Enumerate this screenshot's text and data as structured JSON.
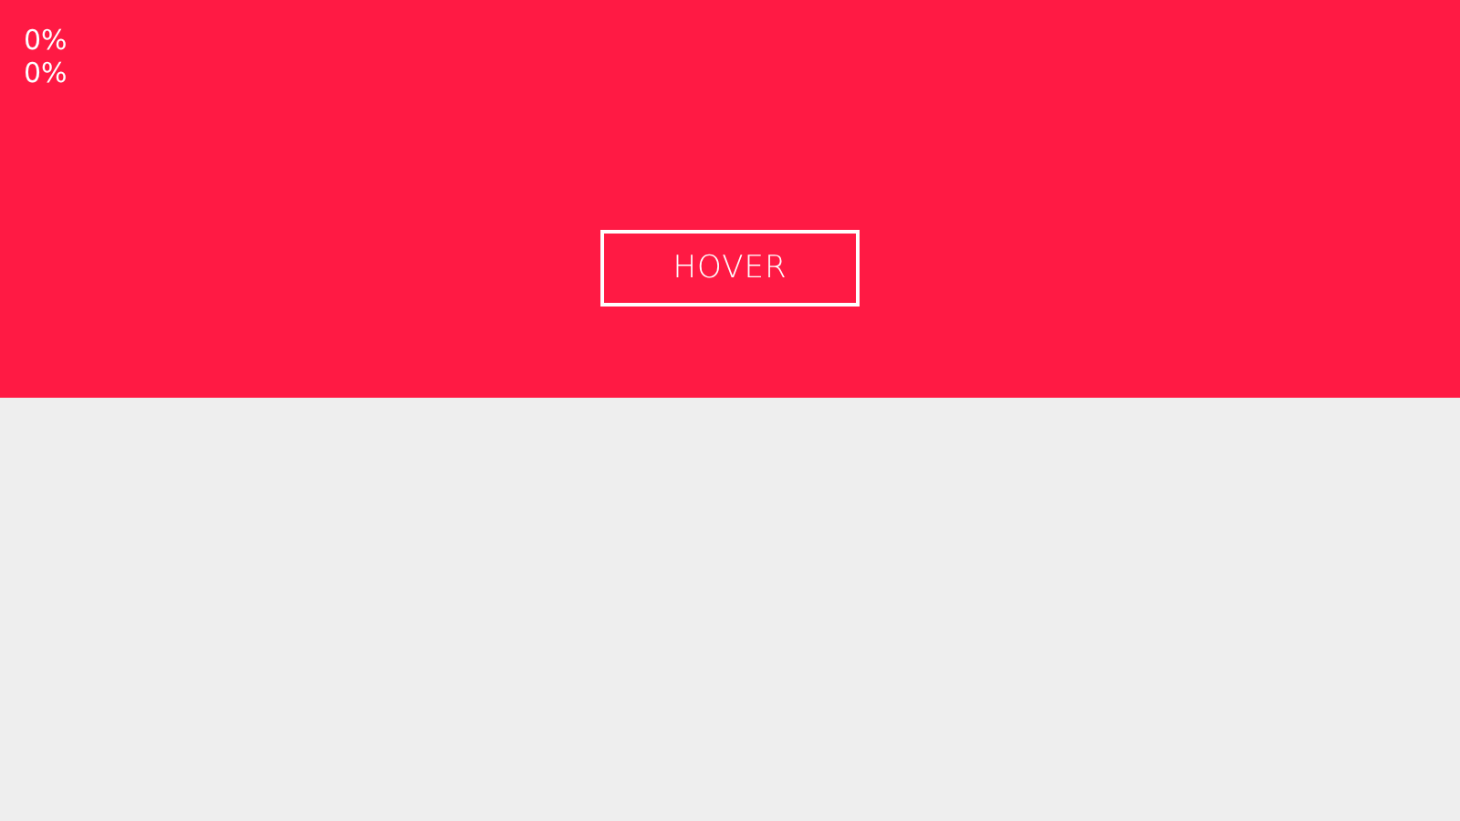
{
  "counters": [
    "0%",
    "0%"
  ],
  "button": {
    "label": "HOVER"
  }
}
